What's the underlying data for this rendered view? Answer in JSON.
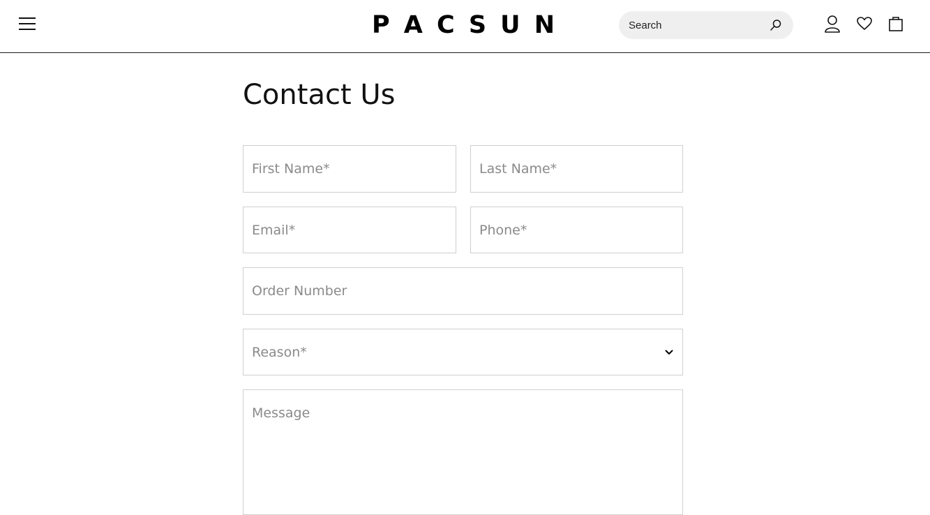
{
  "header": {
    "logo_letters": [
      "P",
      "A",
      "C",
      "S",
      "U",
      "N"
    ],
    "search_placeholder": "Search",
    "icons": {
      "menu": "menu-icon",
      "search": "search-icon",
      "account": "user-icon",
      "wishlist": "heart-icon",
      "cart": "shopping-bag-icon"
    }
  },
  "page": {
    "title": "Contact Us"
  },
  "form": {
    "first_name_placeholder": "First Name*",
    "last_name_placeholder": "Last Name*",
    "email_placeholder": "Email*",
    "phone_placeholder": "Phone*",
    "order_number_placeholder": "Order Number",
    "reason_label": "Reason*",
    "message_placeholder": "Message"
  },
  "colors": {
    "border": "#cfcfcf",
    "placeholder": "#8a8a8a",
    "search_bg": "#efefef",
    "text": "#111111"
  }
}
